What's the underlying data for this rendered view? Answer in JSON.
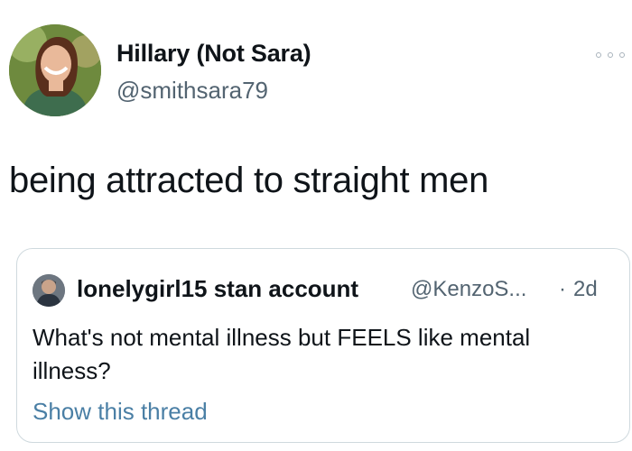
{
  "author": {
    "display_name": "Hillary (Not Sara)",
    "handle": "@smithsara79"
  },
  "tweet": {
    "text": "being attracted to straight men"
  },
  "quoted_tweet": {
    "display_name": "lonelygirl15 stan account",
    "handle": "@KenzoS...",
    "separator": "·",
    "time": "2d",
    "text": "What's not mental illness but FEELS like mental illness?",
    "show_thread_label": "Show this thread"
  },
  "colors": {
    "text": "#0f1419",
    "secondary": "#536471",
    "link": "#4a7fa5",
    "border": "#cfd9de"
  }
}
